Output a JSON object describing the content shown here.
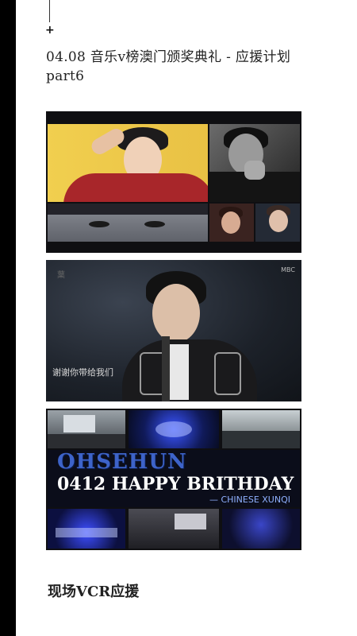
{
  "header": {
    "plus_icon": "+",
    "title_line1": "04.08 音乐v榜澳门颁奖典礼 - 应援计划",
    "title_line2": "part6"
  },
  "panels": {
    "vcr_still": {
      "subtitle": "谢谢你带给我们",
      "watermark": "葉",
      "tv_logo": "MBC"
    },
    "birthday": {
      "name": "OHSEHUN",
      "headline": "0412 HAPPY BRITHDAY",
      "signature": "— CHINESE XUNQI"
    }
  },
  "footer": {
    "heading": "现场VCR应援"
  }
}
